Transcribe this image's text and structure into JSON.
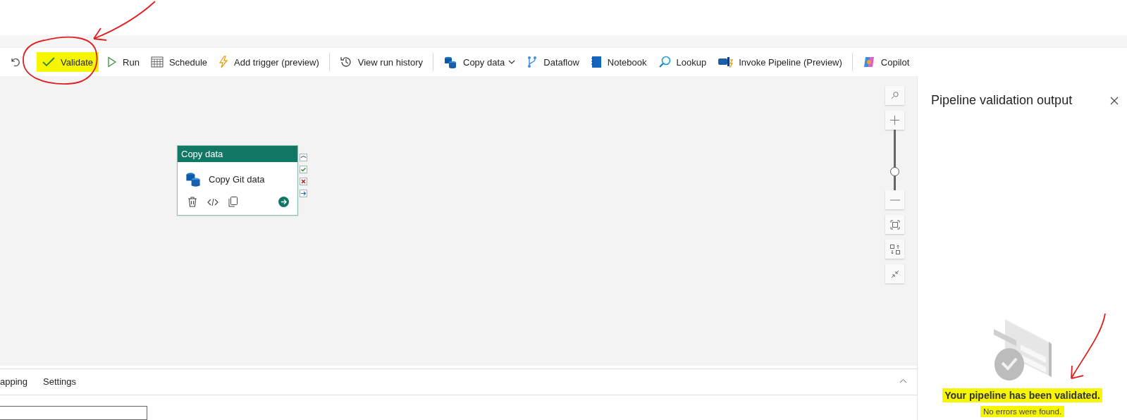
{
  "toolbar": {
    "items": [
      {
        "kind": "icon"
      },
      {
        "kind": "button",
        "label": "Validate",
        "highlighted": true
      },
      {
        "kind": "button",
        "label": "Run",
        "highlighted": false
      },
      {
        "kind": "button",
        "label": "Schedule",
        "highlighted": false
      },
      {
        "kind": "button",
        "label": "Add trigger (preview)",
        "highlighted": false
      },
      {
        "kind": "separator"
      },
      {
        "kind": "button",
        "label": "View run history",
        "highlighted": false
      },
      {
        "kind": "separator"
      },
      {
        "kind": "dropdown",
        "label": "Copy data",
        "highlighted": false
      },
      {
        "kind": "button",
        "label": "Dataflow",
        "highlighted": false
      },
      {
        "kind": "button",
        "label": "Notebook",
        "highlighted": false
      },
      {
        "kind": "button",
        "label": "Lookup",
        "highlighted": false
      },
      {
        "kind": "button",
        "label": "Invoke Pipeline (Preview)",
        "highlighted": false
      },
      {
        "kind": "separator"
      },
      {
        "kind": "button",
        "label": "Copilot",
        "highlighted": false
      }
    ]
  },
  "canvas": {
    "activity": {
      "type": "Copy data",
      "name": "Copy Git data"
    },
    "zoom_slider": {
      "level": 0.3
    }
  },
  "validation_panel": {
    "title": "Pipeline validation output",
    "message": "Your pipeline has been validated.",
    "detail": "No errors were found.",
    "highlighted": true
  },
  "bottom_panel": {
    "tabs": [
      {
        "label": "apping",
        "selected": false
      },
      {
        "label": "Settings",
        "selected": false
      }
    ]
  }
}
